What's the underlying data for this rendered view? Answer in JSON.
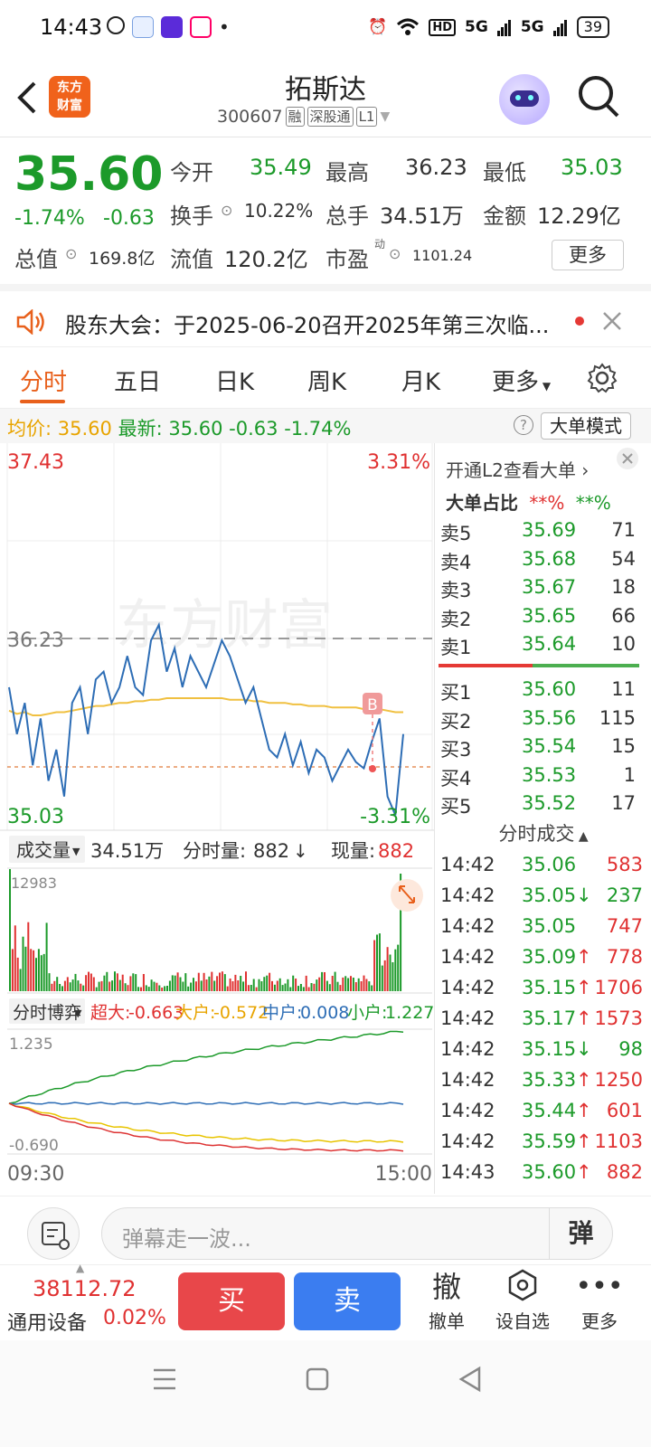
{
  "status_bar": {
    "time": "14:43",
    "battery": "39",
    "network_labels": [
      "HD",
      "5G",
      "5G"
    ]
  },
  "header": {
    "logo_line1": "东方",
    "logo_line2": "财富",
    "title": "拓斯达",
    "code": "300607",
    "tags": [
      "融",
      "深股通",
      "L1"
    ]
  },
  "quote": {
    "price": "35.60",
    "change_pct": "-1.74%",
    "change_abs": "-0.63",
    "open_label": "今开",
    "open": "35.49",
    "high_label": "最高",
    "high": "36.23",
    "low_label": "最低",
    "low": "35.03",
    "turnover_label": "换手",
    "turnover": "10.22%",
    "volume_label": "总手",
    "volume": "34.51万",
    "amount_label": "金额",
    "amount": "12.29亿",
    "mktcap_label": "总值",
    "mktcap": "169.8亿",
    "float_label": "流值",
    "float": "120.2亿",
    "pe_label": "市盈",
    "pe_sup": "动",
    "pe": "1101.24",
    "more_label": "更多"
  },
  "notice": {
    "text": "股东大会：于2025-06-20召开2025年第三次临..."
  },
  "tabs": [
    "分时",
    "五日",
    "日K",
    "周K",
    "月K",
    "更多"
  ],
  "info_line": {
    "avg_label": "均价:",
    "avg": "35.60",
    "latest_label": "最新:",
    "latest": "35.60",
    "change_abs": "-0.63",
    "change_pct": "-1.74%",
    "big_order_mode": "大单模式"
  },
  "chart_labels": {
    "y_max": "37.43",
    "y_max_pct": "3.31%",
    "ref_line": "36.23",
    "y_min": "35.03",
    "y_min_pct": "-3.31%",
    "b_marker": "B",
    "watermark": "东方财富"
  },
  "volume_bar_labels": {
    "selector": "成交量",
    "total": "34.51万",
    "minute_label": "分时量:",
    "minute_val": "882",
    "now_label": "现量:",
    "now_val": "882",
    "max": "12983"
  },
  "game_labels": {
    "selector": "分时博弈",
    "super_label": "超大:",
    "super": "-0.663",
    "large_label": "大户:",
    "large": "-0.572",
    "mid_label": "中户:",
    "mid": "0.008",
    "small_label": "小户:",
    "small": "1.227",
    "max": "1.235",
    "min": "-0.690",
    "time_start": "09:30",
    "time_end": "15:00"
  },
  "chart_data": {
    "type": "line",
    "title": "",
    "xlabel": "",
    "ylabel": "",
    "ylim": [
      35.03,
      37.43
    ],
    "reference_line": 36.23,
    "prev_close_line": 35.6,
    "x_range": [
      "09:30",
      "15:00"
    ],
    "series": [
      {
        "values": [
          35.9,
          35.6,
          35.8,
          35.4,
          35.7,
          35.3,
          35.5,
          35.2,
          35.8,
          35.9,
          35.6,
          35.95,
          36.0,
          35.8,
          35.9,
          36.1,
          35.9,
          35.85,
          36.2,
          36.3,
          36.0,
          36.15,
          35.9,
          36.1,
          36.0,
          35.9,
          36.05,
          36.2,
          36.1,
          35.95,
          35.8,
          35.9,
          35.7,
          35.5,
          35.45,
          35.6,
          35.4,
          35.55,
          35.35,
          35.5,
          35.45,
          35.3,
          35.4,
          35.5,
          35.42,
          35.38,
          35.55,
          35.7,
          35.2,
          35.08,
          35.6
        ]
      },
      {
        "values": [
          35.75,
          35.73,
          35.74,
          35.72,
          35.72,
          35.73,
          35.74,
          35.74,
          35.75,
          35.76,
          35.77,
          35.78,
          35.78,
          35.79,
          35.8,
          35.8,
          35.81,
          35.81,
          35.82,
          35.82,
          35.83,
          35.83,
          35.83,
          35.83,
          35.83,
          35.83,
          35.83,
          35.83,
          35.82,
          35.82,
          35.82,
          35.81,
          35.81,
          35.8,
          35.8,
          35.8,
          35.79,
          35.79,
          35.78,
          35.78,
          35.78,
          35.77,
          35.77,
          35.77,
          35.77,
          35.76,
          35.76,
          35.76,
          35.75,
          35.74,
          35.74
        ]
      }
    ]
  },
  "order_book": {
    "big_order_link": "开通L2查看大单",
    "big_ratio_label": "大单占比",
    "big_ratio_sell": "**%",
    "big_ratio_buy": "**%",
    "asks": [
      {
        "label": "卖5",
        "price": "35.69",
        "vol": "71"
      },
      {
        "label": "卖4",
        "price": "35.68",
        "vol": "54"
      },
      {
        "label": "卖3",
        "price": "35.67",
        "vol": "18"
      },
      {
        "label": "卖2",
        "price": "35.65",
        "vol": "66"
      },
      {
        "label": "卖1",
        "price": "35.64",
        "vol": "10"
      }
    ],
    "bids": [
      {
        "label": "买1",
        "price": "35.60",
        "vol": "11"
      },
      {
        "label": "买2",
        "price": "35.56",
        "vol": "115"
      },
      {
        "label": "买3",
        "price": "35.54",
        "vol": "15"
      },
      {
        "label": "买4",
        "price": "35.53",
        "vol": "1"
      },
      {
        "label": "买5",
        "price": "35.52",
        "vol": "17"
      }
    ],
    "ask_bid_ratio": 0.47
  },
  "trades": {
    "title": "分时成交",
    "rows": [
      {
        "time": "14:42",
        "price": "35.06",
        "dir": "",
        "vol": "583",
        "color": "red"
      },
      {
        "time": "14:42",
        "price": "35.05",
        "dir": "↓",
        "vol": "237",
        "color": "green"
      },
      {
        "time": "14:42",
        "price": "35.05",
        "dir": "",
        "vol": "747",
        "color": "red"
      },
      {
        "time": "14:42",
        "price": "35.09",
        "dir": "↑",
        "vol": "778",
        "color": "red"
      },
      {
        "time": "14:42",
        "price": "35.15",
        "dir": "↑",
        "vol": "1706",
        "color": "red"
      },
      {
        "time": "14:42",
        "price": "35.17",
        "dir": "↑",
        "vol": "1573",
        "color": "red"
      },
      {
        "time": "14:42",
        "price": "35.15",
        "dir": "↓",
        "vol": "98",
        "color": "green"
      },
      {
        "time": "14:42",
        "price": "35.33",
        "dir": "↑",
        "vol": "1250",
        "color": "red"
      },
      {
        "time": "14:42",
        "price": "35.44",
        "dir": "↑",
        "vol": "601",
        "color": "red"
      },
      {
        "time": "14:42",
        "price": "35.59",
        "dir": "↑",
        "vol": "1103",
        "color": "red"
      },
      {
        "time": "14:43",
        "price": "35.60",
        "dir": "↑",
        "vol": "882",
        "color": "red"
      }
    ]
  },
  "danmu": {
    "placeholder": "弹幕走一波...",
    "btn": "弹"
  },
  "bottom_bar": {
    "index_value": "38112.72",
    "index_name": "通用设备",
    "index_change": "0.02%",
    "buy": "买",
    "sell": "卖",
    "cancel_icon": "撤",
    "cancel_label": "撤单",
    "watch_label": "设自选",
    "more_label": "更多"
  },
  "colors": {
    "up": "#e03131",
    "down": "#1c9a2a",
    "accent": "#e8601c",
    "price_line": "#2d6db5",
    "avg_line": "#f0c040"
  }
}
